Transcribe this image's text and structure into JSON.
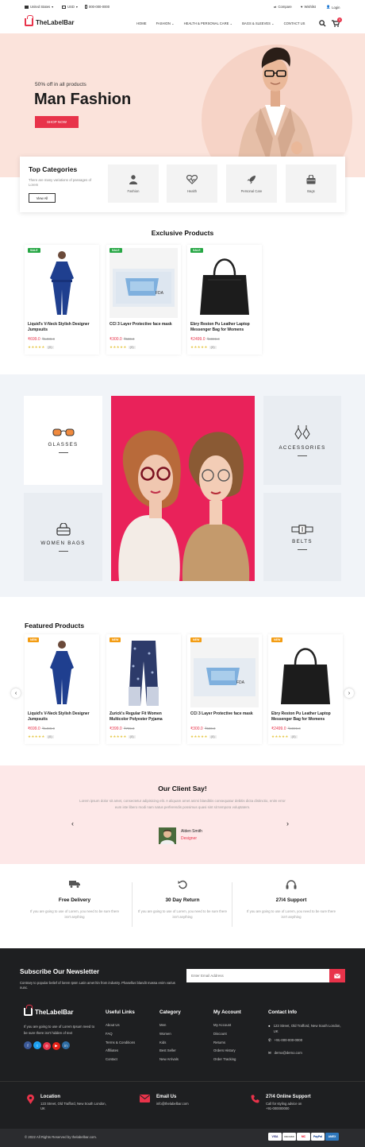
{
  "topbar": {
    "country": "United States",
    "currency": "USD",
    "phone": "000-000-0000",
    "compare": "Compare",
    "wishlist": "Wishlist",
    "login": "Login"
  },
  "header": {
    "logo": "TheLabelBar",
    "nav": [
      "HOME",
      "FASHION",
      "HEALTH & PERSONAL CARE",
      "BAGS & SLEEVES",
      "CONTACT US"
    ],
    "cart_count": "0"
  },
  "hero": {
    "offer": "50% off in all products",
    "title": "Man Fashion",
    "button": "SHOP NOW"
  },
  "categories": {
    "title": "Top Categories",
    "desc": "There are many variations of passages of Lorem",
    "button": "View All",
    "items": [
      "Fashion",
      "Health",
      "Personal Care",
      "Bags"
    ]
  },
  "exclusive": {
    "title": "Exclusive Products",
    "products": [
      {
        "badge": "SALE",
        "name": "Liquid's V-Neck Stylish Designer Jumpsuits",
        "price": "₹699.0",
        "old": "₹1499.0",
        "reviews": "(0)"
      },
      {
        "badge": "SALE",
        "name": "CCI 3 Layer Protective face mask",
        "price": "₹300.0",
        "old": "₹500.0",
        "reviews": "(0)"
      },
      {
        "badge": "SALE",
        "name": "Ebry Reston Pu Leather Laptop Messenger Bag for Womens",
        "price": "₹2499.0",
        "old": "₹4999.0",
        "reviews": "(0)"
      }
    ]
  },
  "promo": {
    "glasses": "GLASSES",
    "women_bags": "WOMEN BAGS",
    "accessories": "ACCESSORIES",
    "belts": "BELTS"
  },
  "featured": {
    "title": "Featured Products",
    "products": [
      {
        "badge": "NEW",
        "name": "Liquid's V-Neck Stylish Designer Jumpsuits",
        "price": "₹699.0",
        "old": "₹1499.0",
        "reviews": "(0)"
      },
      {
        "badge": "NEW",
        "name": "Zurick's Regular Fit Women Multicolor Polyester Pyjama",
        "price": "₹399.0",
        "old": "₹799.0",
        "reviews": "(0)"
      },
      {
        "badge": "NEW",
        "name": "CCI 3 Layer Protective face mask",
        "price": "₹300.0",
        "old": "₹500.0",
        "reviews": "(0)"
      },
      {
        "badge": "NEW",
        "name": "Ebry Reston Pu Leather Laptop Messenger Bag for Womens",
        "price": "₹2499.0",
        "old": "₹4999.0",
        "reviews": "(0)"
      }
    ]
  },
  "testimonial": {
    "title": "Our Client Say!",
    "text": "Lorem ipsum dolor sit amet, consectetur adipisicing elit. A aliquam amet animi blanditiis consequatur debitis dicta distinctio, enim error eum iste libero modi nam natus perferendis possimus quasi sint sit tempora voluptatem.",
    "name": "Alden Smith",
    "role": "Designer"
  },
  "features": [
    {
      "title": "Free Delivery",
      "text": "If you are going to use of Lorem, you need to be sure there isn't anything"
    },
    {
      "title": "30 Day Return",
      "text": "If you are going to use of Lorem, you need to be sure there isn't anything"
    },
    {
      "title": "27/4 Support",
      "text": "If you are going to use of Lorem, you need to be sure there isn't anything"
    }
  ],
  "newsletter": {
    "title": "Subscribe Our Newsletter",
    "text": "Contrary to popular belief of lorem Ipsm Latin amet ltin from industry. Phasellus blandit massa enim varius nunc.",
    "placeholder": "Enter Email Address"
  },
  "footer": {
    "logo": "TheLabelBar",
    "about": "If you are going to use of Lorem Ipsum need to be sure there isn't hidden of text",
    "useful_title": "Useful Links",
    "useful": [
      "About Us",
      "FAQ",
      "Terms & Conditions",
      "Affiliates",
      "Contact"
    ],
    "category_title": "Category",
    "category": [
      "Men",
      "Women",
      "Kids",
      "Best Seller",
      "New Arrivals"
    ],
    "account_title": "My Account",
    "account": [
      "My Account",
      "Discount",
      "Returns",
      "Orders History",
      "Order Tracking"
    ],
    "contact_title": "Contact Info",
    "address": "123 Street, Old Trafford, New South London, UK",
    "phone": "+91-000-000-0000",
    "email": "demo@demo.com",
    "location_title": "Location",
    "location_text": "123 Street, Old Trafford, New South London, UK",
    "email_title": "Email Us",
    "email_text": "info@thelabelbar.com",
    "support_title": "27/4 Online Support",
    "support_text1": "Call for styling advice on",
    "support_text2": "+91-000000000",
    "copyright": "© 2022 All Rights Reserved by thelabelbar.com.",
    "payments": [
      "VISA",
      "DISCOVER",
      "MC",
      "PayPal",
      "AMEX"
    ]
  },
  "colors": {
    "accent": "#e8334a",
    "hero_bg": "#fbe3db",
    "footer_bg": "#1e1f21"
  }
}
